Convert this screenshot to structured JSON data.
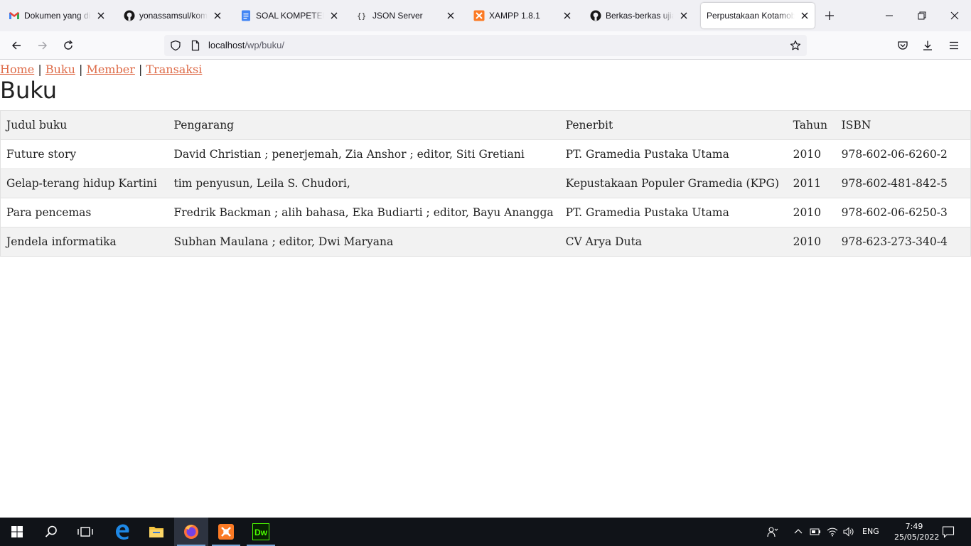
{
  "browser": {
    "tabs": [
      {
        "title": "Dokumen yang dibagikan",
        "icon": "gmail-icon"
      },
      {
        "title": "yonassamsul/kominfo",
        "icon": "github-icon"
      },
      {
        "title": "SOAL KOMPETENSI",
        "icon": "google-docs-icon"
      },
      {
        "title": "JSON Server",
        "icon": "json-server-icon"
      },
      {
        "title": "XAMPP 1.8.1",
        "icon": "xampp-icon"
      },
      {
        "title": "Berkas-berkas ujian",
        "icon": "github-icon"
      },
      {
        "title": "Perpustakaan Kotamobagu",
        "icon": "none"
      }
    ],
    "url_host": "localhost",
    "url_path": "/wp/buku/"
  },
  "page": {
    "nav": [
      "Home",
      "Buku",
      "Member",
      "Transaksi"
    ],
    "separator": "|",
    "title": "Buku",
    "table": {
      "headers": [
        "Judul buku",
        "Pengarang",
        "Penerbit",
        "Tahun",
        "ISBN"
      ],
      "rows": [
        [
          "Future story",
          "David Christian ; penerjemah, Zia Anshor ; editor, Siti Gretiani",
          "PT. Gramedia Pustaka Utama",
          "2010",
          "978-602-06-6260-2"
        ],
        [
          "Gelap-terang hidup Kartini",
          "tim penyusun, Leila S. Chudori,",
          "Kepustakaan Populer Gramedia (KPG)",
          "2011",
          "978-602-481-842-5"
        ],
        [
          "Para pencemas",
          "Fredrik Backman ; alih bahasa, Eka Budiarti ; editor, Bayu Anangga",
          "PT. Gramedia Pustaka Utama",
          "2010",
          "978-602-06-6250-3"
        ],
        [
          "Jendela informatika",
          "Subhan Maulana ; editor, Dwi Maryana",
          "CV Arya Duta",
          "2010",
          "978-623-273-340-4"
        ]
      ]
    }
  },
  "taskbar": {
    "apps": [
      "start-button",
      "search",
      "task-view",
      "edge",
      "file-explorer",
      "firefox",
      "xampp",
      "dreamweaver"
    ],
    "dreamweaver_label": "Dw",
    "lang": "ENG",
    "time": "7:49",
    "date": "25/05/2022"
  },
  "colors": {
    "link": "#de6b48",
    "accent_taskbar": "#101318"
  }
}
